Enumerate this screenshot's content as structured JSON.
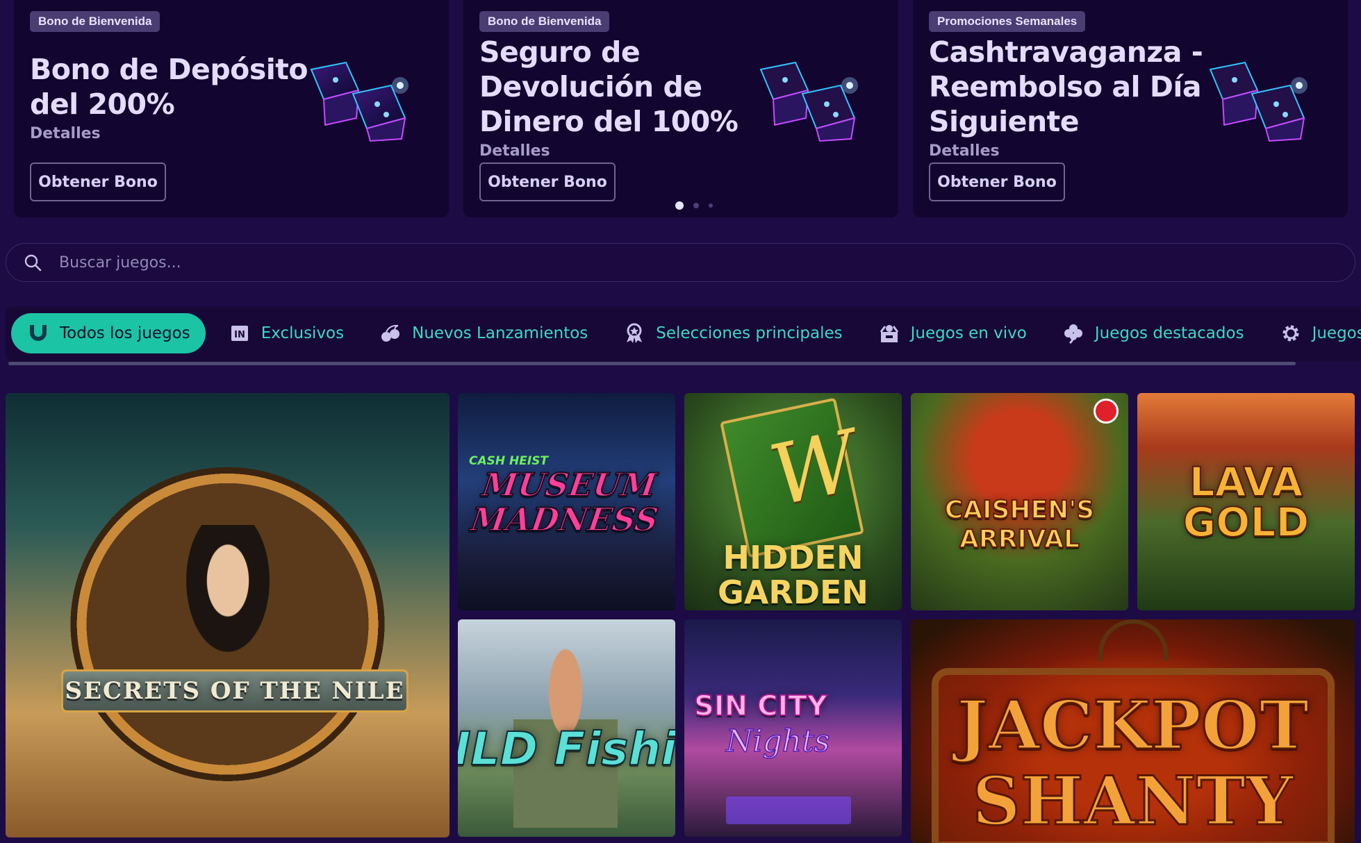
{
  "promos": [
    {
      "badge": "Bono de Bienvenida",
      "title": "Bono de Depósito del 200%",
      "details": "Detalles",
      "button": "Obtener Bono"
    },
    {
      "badge": "Bono de Bienvenida",
      "title": "Seguro de Devolución de Dinero del 100%",
      "details": "Detalles",
      "button": "Obtener Bono"
    },
    {
      "badge": "Promociones Semanales",
      "title": "Cashtravaganza - Reembolso al Día Siguiente",
      "details": "Detalles",
      "button": "Obtener Bono"
    }
  ],
  "carousel": {
    "slide_count": 3,
    "active_index": 0
  },
  "search": {
    "placeholder": "Buscar juegos..."
  },
  "categories": [
    {
      "label": "Todos los juegos",
      "icon": "horseshoe-icon",
      "active": true
    },
    {
      "label": "Exclusivos",
      "icon": "exclusive-icon",
      "active": false
    },
    {
      "label": "Nuevos Lanzamientos",
      "icon": "cherries-icon",
      "active": false
    },
    {
      "label": "Selecciones principales",
      "icon": "award-ribbon-icon",
      "active": false
    },
    {
      "label": "Juegos en vivo",
      "icon": "dealer-icon",
      "active": false
    },
    {
      "label": "Juegos destacados",
      "icon": "clover-icon",
      "active": false
    },
    {
      "label": "Juegos espec",
      "icon": "gear-icon",
      "active": false
    }
  ],
  "games": {
    "nile": {
      "title": "SECRETS OF THE NILE"
    },
    "museum": {
      "title_top": "CASH HEIST",
      "title": "MUSEUM MADNESS"
    },
    "hidden": {
      "letter": "W",
      "title": "HIDDEN GARDEN"
    },
    "caishen": {
      "title": "CAISHEN'S ARRIVAL"
    },
    "lava": {
      "title": "LAVA GOLD"
    },
    "fish": {
      "title": "ILD Fishi"
    },
    "sin": {
      "title_top": "SIN CITY",
      "title": "Nights"
    },
    "jack": {
      "title_top": "JACKPOT",
      "title": "SHANTY"
    }
  },
  "colors": {
    "background": "#1d0b45",
    "card": "#120530",
    "accent": "#1bc4a4",
    "tab_text": "#3fd8c0"
  }
}
